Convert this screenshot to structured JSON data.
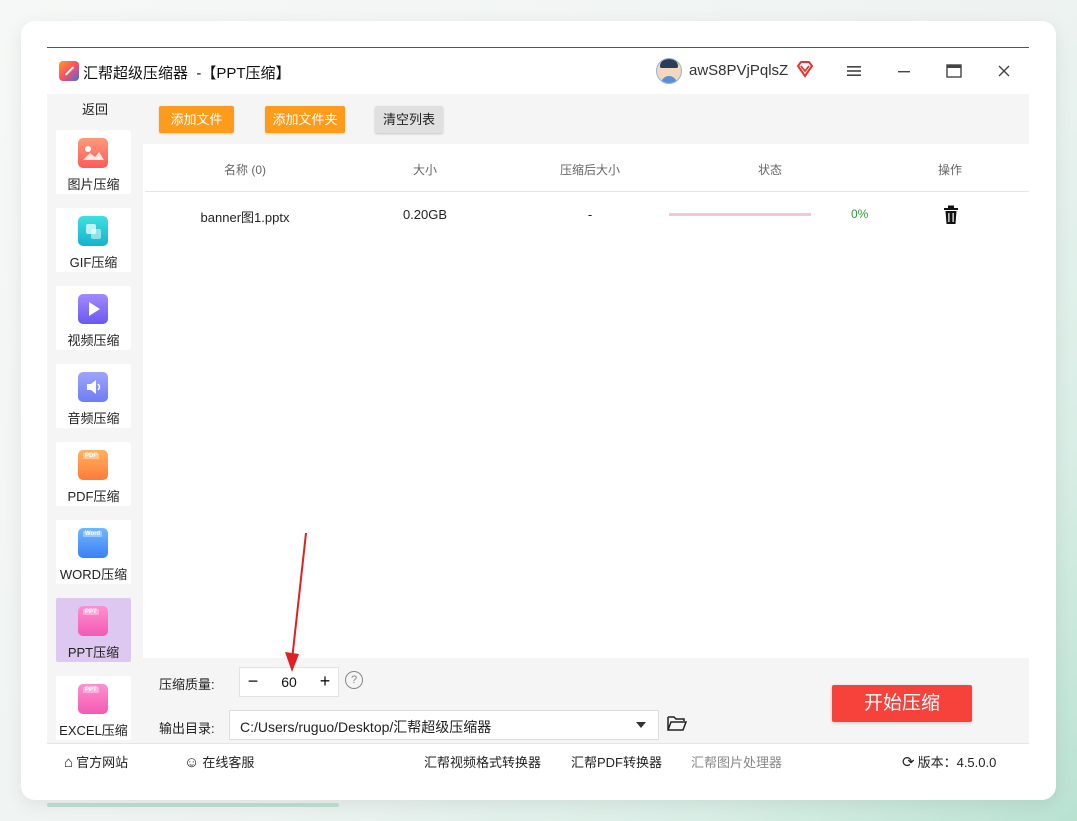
{
  "window": {
    "title": "汇帮超级压缩器  -【PPT压缩】",
    "username": "awS8PVjPqlsZ",
    "icons": {
      "logo": "app-logo-icon",
      "avatar": "avatar",
      "vip": "vip-diamond-icon",
      "menu": "hamburger-menu-icon",
      "minimize": "minimize-icon",
      "maximize": "maximize-icon",
      "close": "close-icon"
    }
  },
  "sidebar": {
    "back": "返回",
    "items": [
      {
        "label": "图片压缩",
        "icon": "image-compress-icon"
      },
      {
        "label": "GIF压缩",
        "icon": "gif-compress-icon"
      },
      {
        "label": "视频压缩",
        "icon": "video-compress-icon"
      },
      {
        "label": "音频压缩",
        "icon": "audio-compress-icon"
      },
      {
        "label": "PDF压缩",
        "icon": "pdf-compress-icon",
        "badge": "PDF"
      },
      {
        "label": "WORD压缩",
        "icon": "word-compress-icon",
        "badge": "Word"
      },
      {
        "label": "PPT压缩",
        "icon": "ppt-compress-icon",
        "badge": "PPT",
        "active": true
      },
      {
        "label": "EXCEL压缩",
        "icon": "excel-compress-icon",
        "badge": "PPT"
      }
    ]
  },
  "toolbar": {
    "add_file": "添加文件",
    "add_folder": "添加文件夹",
    "clear_list": "清空列表"
  },
  "table": {
    "headers": {
      "name": "名称 (0)",
      "size": "大小",
      "after": "压缩后大小",
      "status": "状态",
      "op": "操作"
    },
    "rows": [
      {
        "name": "banner图1.pptx",
        "size": "0.20GB",
        "after": "-",
        "progress": 0,
        "percent": "0%"
      }
    ]
  },
  "settings": {
    "quality_label": "压缩质量:",
    "quality_value": "60",
    "minus": "−",
    "plus": "+",
    "help": "?",
    "output_label": "输出目录:",
    "output_path": "C:/Users/ruguo/Desktop/汇帮超级压缩器",
    "start": "开始压缩"
  },
  "footer": {
    "website": "官方网站",
    "support": "在线客服",
    "video_converter": "汇帮视频格式转换器",
    "pdf_converter": "汇帮PDF转换器",
    "image_processor": "汇帮图片处理器",
    "version_label": "版本：",
    "version": "4.5.0.0"
  },
  "colors": {
    "accent_orange": "#ff9b1a",
    "start_red": "#f7423b",
    "progress": "#f7c6d6",
    "percent_green": "#2e9a3a",
    "active_nav": "#dcc8f0"
  }
}
